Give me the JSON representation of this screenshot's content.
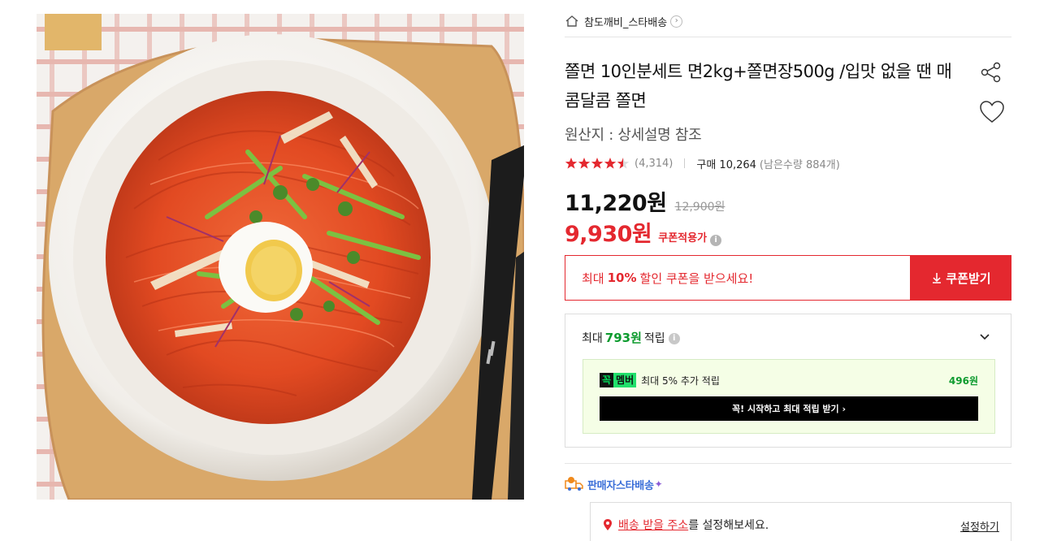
{
  "colors": {
    "accent_red": "#e4282f",
    "points_green": "#0e9b2f",
    "delivery_blue": "#3b6fd8",
    "member_bg": "#f5fee6"
  },
  "product_image": {
    "icon": "food-photo-naengmyeon-bowl"
  },
  "store": {
    "icon": "home-icon",
    "name": "참도깨비_스타배송",
    "chevron": "›"
  },
  "product": {
    "title": "쫄면 10인분세트 면2kg+쫄면장500g /입맛 없을 땐 매콤달콤 쫄면",
    "origin": "원산지 : 상세설명 참조",
    "rating": 4.5,
    "review_count": "(4,314)",
    "sold": "구매 10,264",
    "stock": "(남은수량 884개)"
  },
  "price": {
    "sale": "11,220원",
    "original": "12,900원",
    "coupon_price": "9,930원",
    "coupon_label": "쿠폰적용가",
    "info_glyph": "i"
  },
  "coupon": {
    "prefix": "최대",
    "percent": "10%",
    "suffix": "할인 쿠폰을 받으세요!",
    "button_label": "쿠폰받기"
  },
  "points": {
    "prefix": "최대",
    "amount": "793원",
    "suffix": "적립",
    "member_badge_1": "꼭",
    "member_badge_2": "멤버",
    "member_text": "최대 5% 추가 적립",
    "member_value": "496원",
    "member_button": "꼭! 시작하고 최대 적립 받기 ›"
  },
  "delivery": {
    "label": "판매자스타배송",
    "sparkle": "✦",
    "address_link": "배송 받을 주소",
    "address_suffix": "를 설정해보세요.",
    "set_link": "설정하기"
  }
}
